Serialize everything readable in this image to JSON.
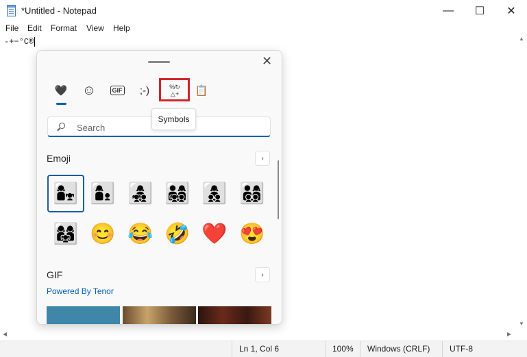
{
  "window": {
    "title": "*Untitled - Notepad",
    "controls": {
      "minimize": "—",
      "maximize": "☐",
      "close": "✕"
    }
  },
  "menu": [
    "File",
    "Edit",
    "Format",
    "View",
    "Help"
  ],
  "document": {
    "text": "-+−°C®"
  },
  "emoji_panel": {
    "close": "✕",
    "tabs": [
      {
        "name": "favorites",
        "glyph": "🖤"
      },
      {
        "name": "emoji",
        "glyph": "☺"
      },
      {
        "name": "gif",
        "glyph": "GIF"
      },
      {
        "name": "kaomoji",
        "glyph": ";-)"
      },
      {
        "name": "symbols",
        "glyph": "%↻ △+"
      },
      {
        "name": "clipboard",
        "glyph": "📋"
      }
    ],
    "tooltip": "Symbols",
    "search_placeholder": "Search",
    "emoji_section": {
      "title": "Emoji",
      "more": "›",
      "items": [
        "👩‍👧",
        "👩‍👦",
        "👩‍👧‍👦",
        "👨‍👩‍👧‍👦",
        "👩‍👦‍👦",
        "👨‍👩‍👦‍👦",
        "👩‍👩‍👧",
        "😊",
        "😂",
        "🤣",
        "❤️",
        "😍"
      ]
    },
    "gif_section": {
      "title": "GIF",
      "more": "›",
      "powered": "Powered By Tenor"
    }
  },
  "statusbar": {
    "position": "Ln 1, Col 6",
    "zoom": "100%",
    "line_ending": "Windows (CRLF)",
    "encoding": "UTF-8"
  },
  "colors": {
    "accent": "#005fb8",
    "highlight": "#d1242b"
  }
}
